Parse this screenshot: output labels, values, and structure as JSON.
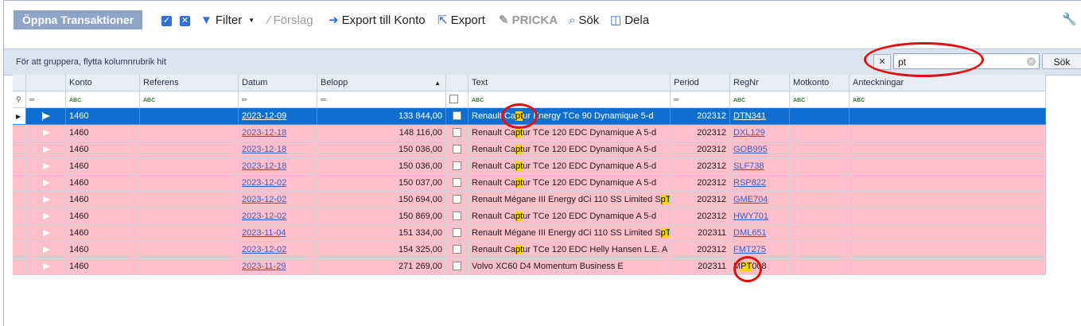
{
  "toolbar": {
    "title": "Öppna Transaktioner",
    "filter_label": "Filter",
    "suggest_label": "Förslag",
    "export_account_label": "Export till Konto",
    "export_label": "Export",
    "pricka_label": "PRICKA",
    "search_label": "Sök",
    "share_label": "Dela"
  },
  "group_panel": {
    "hint": "För att gruppera, flytta kolumnrubrik hit",
    "search_value": "pt",
    "search_button": "Sök"
  },
  "columns": [
    "Konto",
    "Referens",
    "Datum",
    "Belopp",
    "Text",
    "Period",
    "RegNr",
    "Motkonto",
    "Anteckningar"
  ],
  "rows": [
    {
      "konto": "1460",
      "referens": "",
      "datum": "2023-12-09",
      "belopp": "133 844,00",
      "text_pre": "Renault Ca",
      "text_hl": "pt",
      "text_post": "ur Energy TCe 90 Dynamique 5-d",
      "period": "202312",
      "regnr": "DTN341",
      "motkonto": "",
      "anteckningar": "",
      "selected": true
    },
    {
      "konto": "1460",
      "referens": "",
      "datum": "2023-12-18",
      "belopp": "148 116,00",
      "text_pre": "Renault Ca",
      "text_hl": "pt",
      "text_post": "ur TCe 120 EDC Dynamique A 5-d",
      "period": "202312",
      "regnr": "DXL129",
      "motkonto": "",
      "anteckningar": ""
    },
    {
      "konto": "1460",
      "referens": "",
      "datum": "2023-12-18",
      "belopp": "150 036,00",
      "text_pre": "Renault Ca",
      "text_hl": "pt",
      "text_post": "ur TCe 120 EDC Dynamique A 5-d",
      "period": "202312",
      "regnr": "GOB995",
      "motkonto": "",
      "anteckningar": ""
    },
    {
      "konto": "1460",
      "referens": "",
      "datum": "2023-12-18",
      "belopp": "150 036,00",
      "text_pre": "Renault Ca",
      "text_hl": "pt",
      "text_post": "ur TCe 120 EDC Dynamique A 5-d",
      "period": "202312",
      "regnr": "SLF738",
      "motkonto": "",
      "anteckningar": ""
    },
    {
      "konto": "1460",
      "referens": "",
      "datum": "2023-12-02",
      "belopp": "150 037,00",
      "text_pre": "Renault Ca",
      "text_hl": "pt",
      "text_post": "ur TCe 120 EDC Dynamique A 5-d",
      "period": "202312",
      "regnr": "RSP822",
      "motkonto": "",
      "anteckningar": ""
    },
    {
      "konto": "1460",
      "referens": "",
      "datum": "2023-12-02",
      "belopp": "150 694,00",
      "text_pre": "Renault Mégane III Energy dCi 110 SS Limited S",
      "text_hl": "pT",
      "text_post": "",
      "period": "202312",
      "regnr": "GME704",
      "motkonto": "",
      "anteckningar": ""
    },
    {
      "konto": "1460",
      "referens": "",
      "datum": "2023-12-02",
      "belopp": "150 869,00",
      "text_pre": "Renault Ca",
      "text_hl": "pt",
      "text_post": "ur TCe 120 EDC Dynamique A 5-d",
      "period": "202312",
      "regnr": "HWY701",
      "motkonto": "",
      "anteckningar": ""
    },
    {
      "konto": "1460",
      "referens": "",
      "datum": "2023-11-04",
      "belopp": "151 334,00",
      "text_pre": "Renault Mégane III Energy dCi 110 SS Limited S",
      "text_hl": "pT",
      "text_post": "",
      "period": "202311",
      "regnr": "DML651",
      "motkonto": "",
      "anteckningar": ""
    },
    {
      "konto": "1460",
      "referens": "",
      "datum": "2023-12-02",
      "belopp": "154 325,00",
      "text_pre": "Renault Ca",
      "text_hl": "pt",
      "text_post": "ur TCe 120 EDC Helly Hansen L.E. A",
      "period": "202312",
      "regnr": "FMT275",
      "motkonto": "",
      "anteckningar": ""
    },
    {
      "konto": "1460",
      "referens": "",
      "datum": "2023-11-29",
      "belopp": "271 269,00",
      "text_pre": "Volvo XC60 D4 Momentum Business E",
      "text_hl": "",
      "text_post": "",
      "period": "202311",
      "regnr": "MPT008",
      "regnr_pre": "M",
      "regnr_hl": "PT",
      "regnr_post": "008",
      "motkonto": "",
      "anteckningar": ""
    }
  ],
  "colors": {
    "row_bg": "#ffc0cb",
    "selected_bg": "#0f6fd0",
    "highlight": "#ffd400",
    "annotation": "#e01010"
  }
}
